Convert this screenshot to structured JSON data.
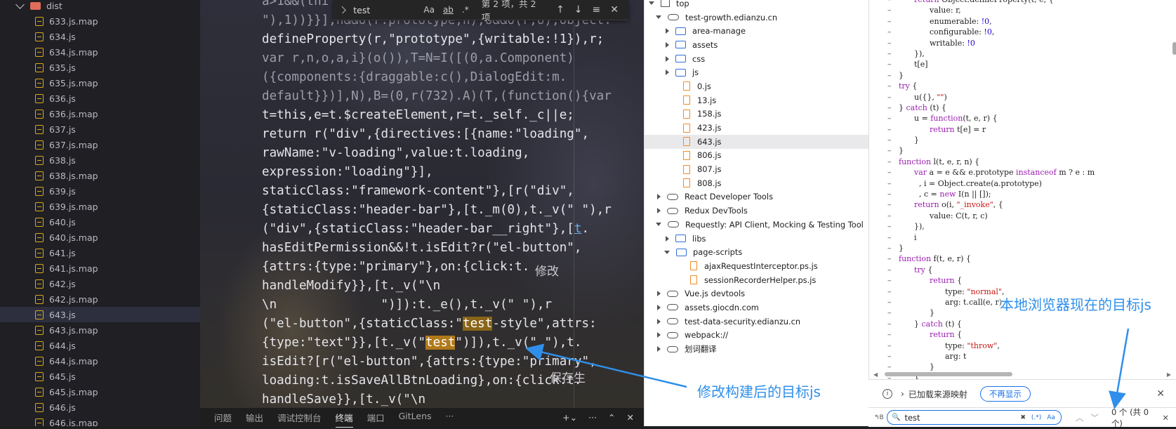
{
  "explorer": {
    "folder": "dist",
    "files": [
      "633.js.map",
      "634.js",
      "634.js.map",
      "635.js",
      "635.js.map",
      "636.js",
      "636.js.map",
      "637.js",
      "637.js.map",
      "638.js",
      "638.js.map",
      "639.js",
      "639.js.map",
      "640.js",
      "640.js.map",
      "641.js",
      "641.js.map",
      "642.js",
      "642.js.map",
      "643.js",
      "643.js.map",
      "644.js",
      "644.js.map",
      "645.js",
      "645.js.map",
      "646.js",
      "646.js.map"
    ],
    "selected": "643.js"
  },
  "findbar": {
    "value": "test",
    "opt_case": "Aa",
    "opt_word": "ab",
    "opt_regex": ".*",
    "count": "第 2 项，共 2 项"
  },
  "editor": {
    "lines": [
      {
        "parts": [
          {
            "t": "a>1&&(thi",
            "c": "dim"
          }
        ]
      },
      {
        "parts": [
          {
            "t": "\"),1))}}],h&&O(r.prototype,n),o&&O(r,o),Object.",
            "c": "dim"
          }
        ]
      },
      {
        "parts": [
          {
            "t": "defineProperty(r,\"prototype\",{writable:!1}),r;"
          }
        ]
      },
      {
        "parts": [
          {
            "t": "var r,n,o,a,i}(o()),T=N=I([(0,a.Component)",
            "c": "dim"
          }
        ]
      },
      {
        "parts": [
          {
            "t": "({components:{draggable:c(),DialogEdit:m.",
            "c": "dim"
          }
        ]
      },
      {
        "parts": [
          {
            "t": "default}})],N),B=(0,r(732).A)(T,(function(){var",
            "c": "dim"
          }
        ]
      },
      {
        "parts": [
          {
            "t": "t=this,e=t.$createElement,r=t._self._c||e;"
          }
        ]
      },
      {
        "parts": [
          {
            "t": "return r(\"div\",{directives:[{name:\"loading\","
          }
        ]
      },
      {
        "parts": [
          {
            "t": "rawName:\"v-loading\",value:t.loading,"
          }
        ]
      },
      {
        "parts": [
          {
            "t": "expression:\"loading\"}],"
          }
        ]
      },
      {
        "parts": [
          {
            "t": "staticClass:\"framework-content\"},[r(\"div\","
          }
        ]
      },
      {
        "parts": [
          {
            "t": "{staticClass:\"header-bar\"},[t._m(0),t._v(\" \"),r"
          }
        ]
      },
      {
        "parts": [
          {
            "t": "(\"div\",{staticClass:\"header-bar__right\"},["
          },
          {
            "t": "t",
            "c": "link"
          },
          {
            "t": "."
          }
        ]
      },
      {
        "parts": [
          {
            "t": "hasEditPermission&&!t.isEdit?r(\"el-button\","
          }
        ]
      },
      {
        "parts": [
          {
            "t": "{attrs:{type:\"primary\"},on:{click:t."
          }
        ]
      },
      {
        "parts": [
          {
            "t": "handleModify}},[t._v(\"\\n"
          }
        ]
      },
      {
        "parts": [
          {
            "t": "\\n              \")]):t._e(),t._v(\" \"),r"
          }
        ]
      },
      {
        "parts": [
          {
            "t": "(\"el-button\",{staticClass:\""
          },
          {
            "t": "test",
            "c": "hl1"
          },
          {
            "t": "-style\",attrs:"
          }
        ]
      },
      {
        "parts": [
          {
            "t": "{type:\"text\"}},[t._v(\""
          },
          {
            "t": "test",
            "c": "hl2"
          },
          {
            "t": "\")]),t._v(\" \"),t."
          }
        ]
      },
      {
        "parts": [
          {
            "t": "isEdit?[r(\"el-button\",{attrs:{type:\"primary\","
          }
        ]
      },
      {
        "parts": [
          {
            "t": "loading:t.isSaveAllBtnLoading},on:{click:t."
          }
        ]
      },
      {
        "parts": [
          {
            "t": "handleSave}},[t._v(\"\\n"
          }
        ]
      }
    ],
    "label_modify": "修改",
    "label_save": "保存生"
  },
  "panel": {
    "tabs": [
      "问题",
      "输出",
      "调试控制台",
      "终端",
      "端口",
      "GitLens",
      "···"
    ],
    "active": "终端"
  },
  "devtree": {
    "rows": [
      {
        "label": "top",
        "icon": "frame",
        "arrow": "down",
        "indent": 0
      },
      {
        "label": "test-growth.edianzu.cn",
        "icon": "cloud",
        "arrow": "down",
        "indent": 1
      },
      {
        "label": "area-manage",
        "icon": "folder",
        "arrow": "right",
        "indent": 2
      },
      {
        "label": "assets",
        "icon": "folder",
        "arrow": "right",
        "indent": 2
      },
      {
        "label": "css",
        "icon": "folder",
        "arrow": "right",
        "indent": 2
      },
      {
        "label": "js",
        "icon": "folder",
        "arrow": "right",
        "indent": 2
      },
      {
        "label": "0.js",
        "icon": "file",
        "arrow": "none",
        "indent": 3
      },
      {
        "label": "13.js",
        "icon": "file",
        "arrow": "none",
        "indent": 3
      },
      {
        "label": "158.js",
        "icon": "file",
        "arrow": "none",
        "indent": 3
      },
      {
        "label": "423.js",
        "icon": "file",
        "arrow": "none",
        "indent": 3
      },
      {
        "label": "643.js",
        "icon": "file",
        "arrow": "none",
        "indent": 3,
        "selected": true
      },
      {
        "label": "806.js",
        "icon": "file",
        "arrow": "none",
        "indent": 3
      },
      {
        "label": "807.js",
        "icon": "file",
        "arrow": "none",
        "indent": 3
      },
      {
        "label": "808.js",
        "icon": "file",
        "arrow": "none",
        "indent": 3
      },
      {
        "label": "React Developer Tools",
        "icon": "cloud",
        "arrow": "right",
        "indent": 1
      },
      {
        "label": "Redux DevTools",
        "icon": "cloud",
        "arrow": "right",
        "indent": 1
      },
      {
        "label": "Requestly: API Client, Mocking & Testing Tool",
        "icon": "cloud",
        "arrow": "down",
        "indent": 1
      },
      {
        "label": "libs",
        "icon": "folder",
        "arrow": "right",
        "indent": 2
      },
      {
        "label": "page-scripts",
        "icon": "folder",
        "arrow": "down",
        "indent": 2
      },
      {
        "label": "ajaxRequestInterceptor.ps.js",
        "icon": "file",
        "arrow": "none",
        "indent": 4
      },
      {
        "label": "sessionRecorderHelper.ps.js",
        "icon": "file",
        "arrow": "none",
        "indent": 4
      },
      {
        "label": "Vue.js devtools",
        "icon": "cloud",
        "arrow": "right",
        "indent": 1
      },
      {
        "label": "assets.giocdn.com",
        "icon": "cloud",
        "arrow": "right",
        "indent": 1
      },
      {
        "label": "test-data-security.edianzu.cn",
        "icon": "cloud",
        "arrow": "right",
        "indent": 1
      },
      {
        "label": "webpack://",
        "icon": "cloud",
        "arrow": "right",
        "indent": 1
      },
      {
        "label": "划词翻译",
        "icon": "cloud",
        "arrow": "right",
        "indent": 1
      }
    ]
  },
  "source": {
    "lines": [
      {
        "i": 1,
        "p": [
          {
            "t": "return ",
            "c": "kw"
          },
          {
            "t": "Object.defineProperty(t, e, {"
          }
        ]
      },
      {
        "i": 2,
        "p": [
          {
            "t": "value: r,"
          }
        ]
      },
      {
        "i": 2,
        "p": [
          {
            "t": "enumerable: "
          },
          {
            "t": "!0",
            "c": "nu"
          },
          {
            "t": ","
          }
        ]
      },
      {
        "i": 2,
        "p": [
          {
            "t": "configurable: "
          },
          {
            "t": "!0",
            "c": "nu"
          },
          {
            "t": ","
          }
        ]
      },
      {
        "i": 2,
        "p": [
          {
            "t": "writable: "
          },
          {
            "t": "!0",
            "c": "nu"
          }
        ]
      },
      {
        "i": 1,
        "p": [
          {
            "t": "}),"
          }
        ]
      },
      {
        "i": 1,
        "p": [
          {
            "t": "t[e]"
          }
        ]
      },
      {
        "i": 0,
        "p": [
          {
            "t": "}"
          }
        ]
      },
      {
        "i": 0,
        "p": [
          {
            "t": "try",
            "c": "kw"
          },
          {
            "t": " {"
          }
        ]
      },
      {
        "i": 1,
        "p": [
          {
            "t": "u({}, "
          },
          {
            "t": "\"\"",
            "c": "st"
          },
          {
            "t": ")"
          }
        ]
      },
      {
        "i": 0,
        "p": [
          {
            "t": "} "
          },
          {
            "t": "catch",
            "c": "kw"
          },
          {
            "t": " (t) {"
          }
        ]
      },
      {
        "i": 1,
        "p": [
          {
            "t": "u = "
          },
          {
            "t": "function",
            "c": "kw"
          },
          {
            "t": "(t, e, r) {"
          }
        ]
      },
      {
        "i": 2,
        "p": [
          {
            "t": "return",
            "c": "kw"
          },
          {
            "t": " t[e] = r"
          }
        ]
      },
      {
        "i": 1,
        "p": [
          {
            "t": "}"
          }
        ]
      },
      {
        "i": 0,
        "p": [
          {
            "t": "}"
          }
        ]
      },
      {
        "i": 0,
        "p": [
          {
            "t": "function",
            "c": "kw"
          },
          {
            "t": " l(t, e, r, n) {"
          }
        ]
      },
      {
        "i": 1,
        "p": [
          {
            "t": "var",
            "c": "kw"
          },
          {
            "t": " a = e && e.prototype "
          },
          {
            "t": "instanceof",
            "c": "kw"
          },
          {
            "t": " m ? e : m"
          }
        ]
      },
      {
        "i": 1,
        "p": [
          {
            "t": "  , i = Object.create(a.prototype)"
          }
        ]
      },
      {
        "i": 1,
        "p": [
          {
            "t": "  , c = "
          },
          {
            "t": "new",
            "c": "kw"
          },
          {
            "t": " I(n || []);"
          }
        ]
      },
      {
        "i": 1,
        "p": [
          {
            "t": "return",
            "c": "kw"
          },
          {
            "t": " o(i, "
          },
          {
            "t": "\"_invoke\"",
            "c": "st"
          },
          {
            "t": ", {"
          }
        ]
      },
      {
        "i": 2,
        "p": [
          {
            "t": "value: C(t, r, c)"
          }
        ]
      },
      {
        "i": 1,
        "p": [
          {
            "t": "}),"
          }
        ]
      },
      {
        "i": 1,
        "p": [
          {
            "t": "i"
          }
        ]
      },
      {
        "i": 0,
        "p": [
          {
            "t": "}"
          }
        ]
      },
      {
        "i": 0,
        "p": [
          {
            "t": "function",
            "c": "kw"
          },
          {
            "t": " f(t, e, r) {"
          }
        ]
      },
      {
        "i": 1,
        "p": [
          {
            "t": "try",
            "c": "kw"
          },
          {
            "t": " {"
          }
        ]
      },
      {
        "i": 2,
        "p": [
          {
            "t": "return",
            "c": "kw"
          },
          {
            "t": " {"
          }
        ]
      },
      {
        "i": 3,
        "p": [
          {
            "t": "type: "
          },
          {
            "t": "\"normal\"",
            "c": "st"
          },
          {
            "t": ","
          }
        ]
      },
      {
        "i": 3,
        "p": [
          {
            "t": "arg: t.call(e, r)"
          }
        ]
      },
      {
        "i": 2,
        "p": [
          {
            "t": "}"
          }
        ]
      },
      {
        "i": 1,
        "p": [
          {
            "t": "} "
          },
          {
            "t": "catch",
            "c": "kw"
          },
          {
            "t": " (t) {"
          }
        ]
      },
      {
        "i": 2,
        "p": [
          {
            "t": "return",
            "c": "kw"
          },
          {
            "t": " {"
          }
        ]
      },
      {
        "i": 3,
        "p": [
          {
            "t": "type: "
          },
          {
            "t": "\"throw\"",
            "c": "st"
          },
          {
            "t": ","
          }
        ]
      },
      {
        "i": 3,
        "p": [
          {
            "t": "arg: t"
          }
        ]
      },
      {
        "i": 2,
        "p": [
          {
            "t": "}"
          }
        ]
      },
      {
        "i": 1,
        "p": [
          {
            "t": "}"
          }
        ]
      }
    ]
  },
  "srcinfo": {
    "text": "已加载来源映射",
    "button": "不再显示"
  },
  "search": {
    "value": "test",
    "opt_regex": "(.*)",
    "opt_case": "Aa",
    "result": "0 个 (共 0 个)"
  },
  "annotations": {
    "modified": "修改构建后的目标js",
    "browser": "本地浏览器现在的目标js"
  },
  "colors": {
    "annotation": "#2f8fea",
    "highlight": "#b07a1a",
    "devtools_accent": "#1a73e8"
  }
}
